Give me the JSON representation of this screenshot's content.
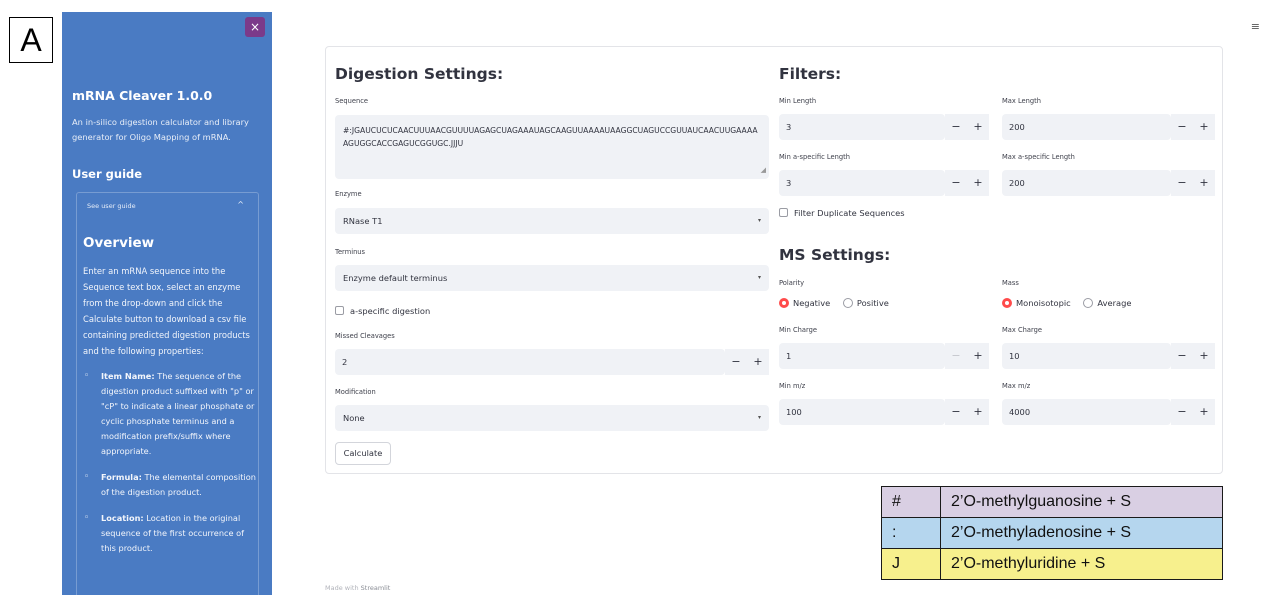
{
  "panel_label": "A",
  "sidebar": {
    "close_icon": "×",
    "app_title": "mRNA Cleaver 1.0.0",
    "app_description": "An in-silico digestion calculator and library generator for Oligo Mapping of mRNA.",
    "user_guide_heading": "User guide",
    "expander_label": "See user guide",
    "expander_chevron": "^",
    "overview_title": "Overview",
    "overview_text": "Enter an mRNA sequence into the Sequence text box, select an enzyme from the drop-down and click the Calculate button to download a csv file containing predicted digestion products and the following properties:",
    "items": [
      {
        "name": "Item Name:",
        "text": " The sequence of the digestion product suffixed with \"p\" or \"cP\" to indicate a linear phosphate or cyclic phosphate terminus and a modification prefix/suffix where appropriate."
      },
      {
        "name": "Formula:",
        "text": " The elemental composition of the digestion product."
      },
      {
        "name": "Location:",
        "text": " Location in the original sequence of the first occurrence of this product."
      }
    ]
  },
  "menu_icon": "≡",
  "digestion": {
    "heading": "Digestion Settings:",
    "sequence_label": "Sequence",
    "sequence_value": "#:JGAUCUCUCAACUUUAACGUUUUAGAGCUAGAAAUAGCAAGUUAAAAUAAGGCUAGUCCGUUAUCAACUUGAAAAAGUGGCACCGAGUCGGUGC.JJJU",
    "enzyme_label": "Enzyme",
    "enzyme_value": "RNase T1",
    "terminus_label": "Terminus",
    "terminus_value": "Enzyme default terminus",
    "aspecific_label": "a-specific digestion",
    "missed_label": "Missed Cleavages",
    "missed_value": "2",
    "modification_label": "Modification",
    "modification_value": "None",
    "calculate_label": "Calculate"
  },
  "filters": {
    "heading": "Filters:",
    "min_length_label": "Min Length",
    "min_length_value": "3",
    "max_length_label": "Max Length",
    "max_length_value": "200",
    "min_aspec_label": "Min a-specific Length",
    "min_aspec_value": "3",
    "max_aspec_label": "Max a-specific Length",
    "max_aspec_value": "200",
    "dup_label": "Filter Duplicate Sequences"
  },
  "ms": {
    "heading": "MS Settings:",
    "polarity_label": "Polarity",
    "polarity_options": [
      "Negative",
      "Positive"
    ],
    "polarity_selected": "Negative",
    "mass_label": "Mass",
    "mass_options": [
      "Monoisotopic",
      "Average"
    ],
    "mass_selected": "Monoisotopic",
    "min_charge_label": "Min Charge",
    "min_charge_value": "1",
    "max_charge_label": "Max Charge",
    "max_charge_value": "10",
    "min_mz_label": "Min m/z",
    "min_mz_value": "100",
    "max_mz_label": "Max m/z",
    "max_mz_value": "4000"
  },
  "stepper": {
    "minus": "−",
    "plus": "+"
  },
  "select_arrow": "▾",
  "footer": {
    "prefix": "Made with ",
    "brand": "Streamlit"
  },
  "legend": [
    {
      "symbol": "#",
      "meaning": "2’O-methylguanosine + S",
      "color": "#d9cfe3"
    },
    {
      "symbol": ":",
      "meaning": "2’O-methyladenosine + S",
      "color": "#b5d6ee"
    },
    {
      "symbol": "J",
      "meaning": "2’O-methyluridine + S",
      "color": "#f7f08d"
    }
  ]
}
